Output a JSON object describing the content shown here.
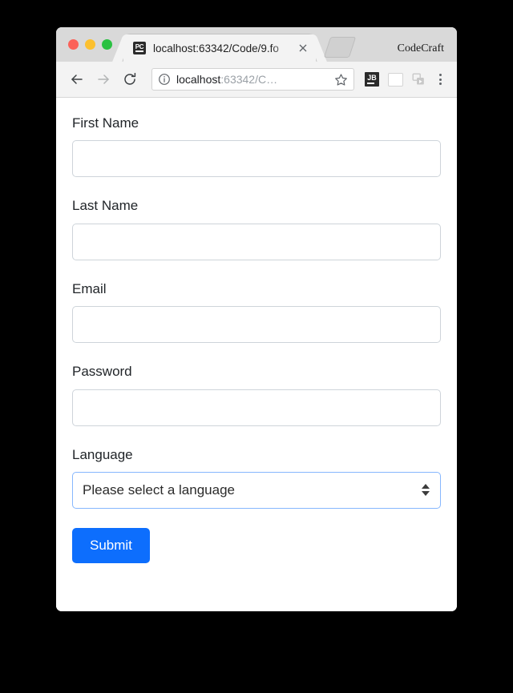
{
  "browser": {
    "window_brand": "CodeCraft",
    "traffic_lights": [
      "close",
      "minimize",
      "maximize"
    ],
    "tab": {
      "favicon_label": "PC",
      "title": "localhost:63342/Code/9.fo",
      "close_label": "×"
    },
    "toolbar": {
      "back_icon": "back-arrow-icon",
      "forward_icon": "forward-arrow-icon",
      "reload_icon": "reload-icon",
      "info_icon": "info-circle-icon",
      "url_host": "localhost",
      "url_rest": ":63342/C…",
      "star_icon": "bookmark-star-icon",
      "jetbrains_label": "JB",
      "blank_ext_icon": "blank-extension-icon",
      "cast_icon": "cast-media-icon",
      "menu_icon": "three-dot-menu-icon"
    }
  },
  "form": {
    "fields": [
      {
        "label": "First Name",
        "value": "",
        "placeholder": "",
        "type": "text"
      },
      {
        "label": "Last Name",
        "value": "",
        "placeholder": "",
        "type": "text"
      },
      {
        "label": "Email",
        "value": "",
        "placeholder": "",
        "type": "email"
      },
      {
        "label": "Password",
        "value": "",
        "placeholder": "",
        "type": "password"
      }
    ],
    "language": {
      "label": "Language",
      "selected": "Please select a language",
      "options": [
        "Please select a language"
      ]
    },
    "submit_label": "Submit"
  },
  "colors": {
    "accent": "#0d6efd",
    "select_focus_border": "#86b7fe",
    "input_border": "#ced4da",
    "text": "#212529",
    "page_background": "#000000"
  }
}
